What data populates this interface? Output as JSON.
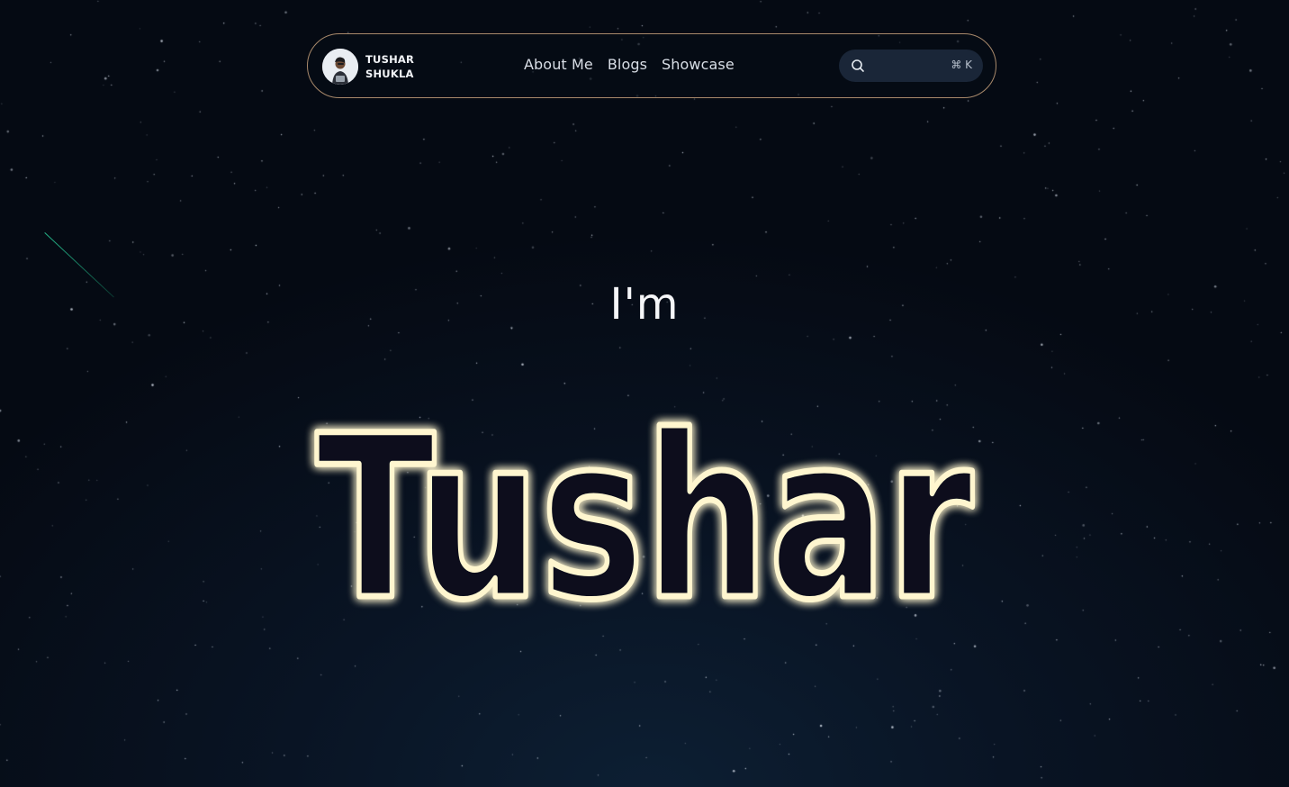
{
  "brand": {
    "name_line1": "TUSHAR",
    "name_line2": "SHUKLA"
  },
  "nav": {
    "links": [
      {
        "label": "About Me"
      },
      {
        "label": "Blogs"
      },
      {
        "label": "Showcase"
      }
    ]
  },
  "search": {
    "icon": "search-icon",
    "shortcut": "⌘ K"
  },
  "hero": {
    "intro": "I'm",
    "name": "Tushar"
  },
  "colors": {
    "nav_border": "#a8896b",
    "glow": "#ffd54a",
    "shooting_star": "#28c896"
  }
}
